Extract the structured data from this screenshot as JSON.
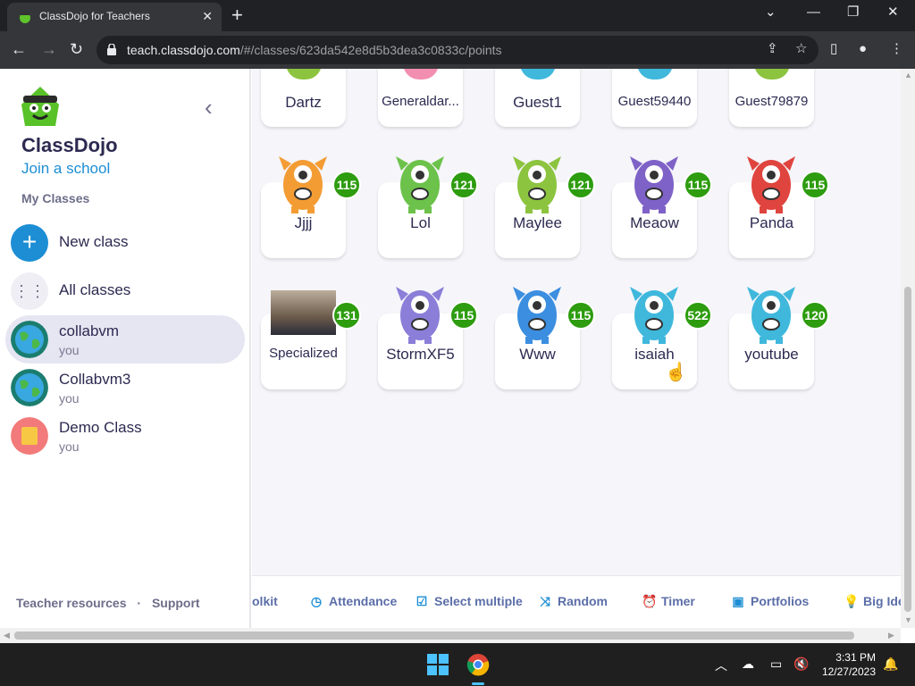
{
  "browser": {
    "tab_title": "ClassDojo for Teachers",
    "url_host": "teach.classdojo.com",
    "url_path": "/#/classes/623da542e8d5b3dea3c0833c/points"
  },
  "sidebar": {
    "brand": "ClassDojo",
    "join_link": "Join a school",
    "section_title": "My Classes",
    "new_class": "New class",
    "all_classes": "All classes",
    "classes": [
      {
        "name": "collabvm",
        "owner": "you"
      },
      {
        "name": "Collabvm3",
        "owner": "you"
      },
      {
        "name": "Demo Class",
        "owner": "you"
      }
    ],
    "footer_resources": "Teacher resources",
    "footer_sep": "·",
    "footer_support": "Support"
  },
  "students": {
    "row1": [
      {
        "name": "Dartz"
      },
      {
        "name": "Generaldar..."
      },
      {
        "name": "Guest1"
      },
      {
        "name": "Guest59440"
      },
      {
        "name": "Guest79879"
      }
    ],
    "row2": [
      {
        "name": "Jjjj",
        "points": "115",
        "color": "#f39c34"
      },
      {
        "name": "Lol",
        "points": "121",
        "color": "#6cc24a"
      },
      {
        "name": "Maylee",
        "points": "121",
        "color": "#8cc43f"
      },
      {
        "name": "Meaow",
        "points": "115",
        "color": "#7e62c7"
      },
      {
        "name": "Panda",
        "points": "115",
        "color": "#e0443e"
      }
    ],
    "row3": [
      {
        "name": "Specialized",
        "points": "131"
      },
      {
        "name": "StormXF5",
        "points": "115",
        "color": "#8a7ed8"
      },
      {
        "name": "Www",
        "points": "115",
        "color": "#3b8ee0"
      },
      {
        "name": "isaiah",
        "points": "522",
        "color": "#3fb8dc"
      },
      {
        "name": "youtube",
        "points": "120",
        "color": "#3fb8dc"
      }
    ]
  },
  "toolbar_bottom": {
    "toolkit": "olkit",
    "attendance": "Attendance",
    "select_multiple": "Select multiple",
    "random": "Random",
    "timer": "Timer",
    "portfolios": "Portfolios",
    "big_ideas": "Big Ide"
  },
  "taskbar": {
    "time": "3:31 PM",
    "date": "12/27/2023"
  },
  "colors": {
    "points_badge": "#2d9c0f",
    "brand_blue": "#1d8ed4",
    "active_row": "#e6e6f2"
  }
}
